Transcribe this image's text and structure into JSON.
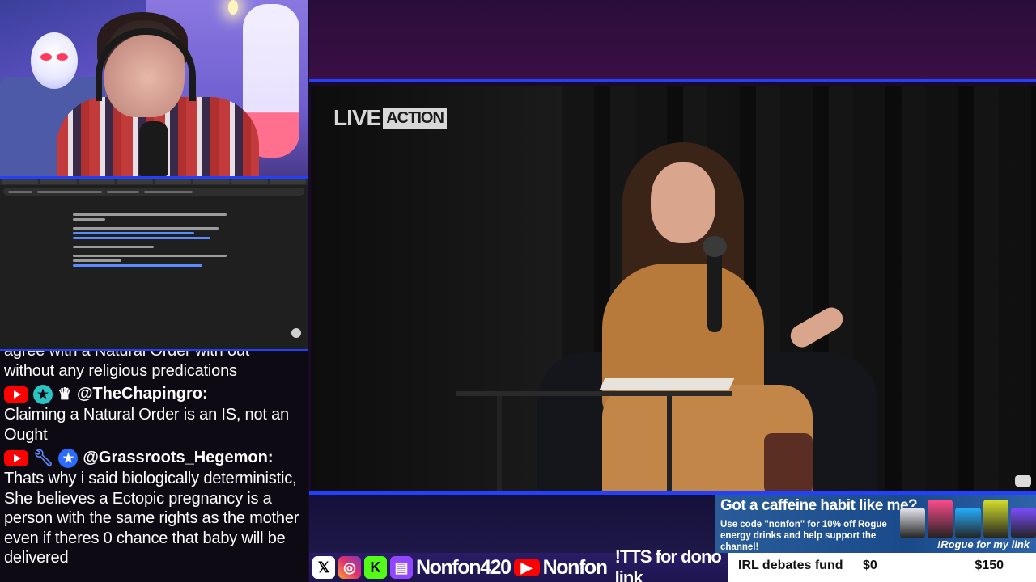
{
  "video": {
    "logo_live": "LIVE",
    "logo_action": "ACTION"
  },
  "chat": {
    "partial_line": "agree with a Natural Order with out",
    "messages": [
      {
        "author": "",
        "text": "without any religious predications"
      },
      {
        "author": "@TheChapingro:",
        "text": "Claiming a Natural Order is an IS, not an Ought",
        "icons": [
          "youtube-icon",
          "moderator-badge-icon",
          "crown-icon"
        ]
      },
      {
        "author": "@Grassroots_Hegemon:",
        "text": "Thats why i said biologically deterministic, She believes a Ectopic pregnancy is a person with the same rights as the mother even if theres 0 chance that baby will be delivered",
        "icons": [
          "youtube-icon",
          "wrench-icon",
          "member-badge-icon"
        ]
      }
    ]
  },
  "promo": {
    "heading": "Got a caffeine habit like me?",
    "body": "Use code \"nonfon\" for 10% off Rogue energy drinks and help support the channel!",
    "tagline": "!Rogue for my link",
    "can_colors": [
      "#e8e8f0",
      "#ff4b8b",
      "#27b0ff",
      "#d6e12a",
      "#7d4dff"
    ]
  },
  "socials": {
    "handle_main": "Nonfon420",
    "handle_yt": "Nonfon",
    "tts": "!TTS for dono link",
    "icons": [
      "x-icon",
      "instagram-icon",
      "kick-icon",
      "twitch-icon",
      "youtube-icon"
    ]
  },
  "goal": {
    "title": "IRL debates fund",
    "current": "$0",
    "target": "$150",
    "progress": 0
  },
  "colors": {
    "accent": "#2340ff",
    "youtube": "#ff0000"
  }
}
